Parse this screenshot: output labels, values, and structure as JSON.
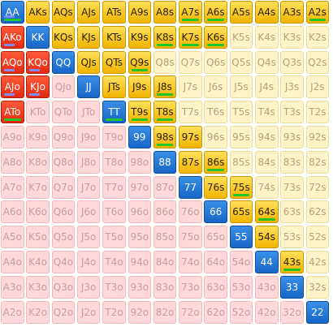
{
  "ranks": [
    "A",
    "K",
    "Q",
    "J",
    "T",
    "9",
    "8",
    "7",
    "6",
    "5",
    "4",
    "3",
    "2"
  ],
  "colors": {
    "pair": "#1866c8",
    "suited": "#f2b400",
    "light_suited": "#fff3c8",
    "offsuit_selected": "#e52a10",
    "offsuit": "#ffd9d9",
    "indicator_green": "#22c52a",
    "indicator_blue": "#7f8ef5"
  },
  "selected_pairs": [
    "AA",
    "KK",
    "QQ",
    "JJ",
    "TT",
    "99",
    "88",
    "77",
    "66",
    "55",
    "44",
    "33",
    "22"
  ],
  "selected_suited": [
    "AKs",
    "AQs",
    "AJs",
    "ATs",
    "A9s",
    "A8s",
    "A7s",
    "A6s",
    "A5s",
    "A4s",
    "A3s",
    "A2s",
    "KQs",
    "KJs",
    "KTs",
    "K9s",
    "K8s",
    "K7s",
    "K6s",
    "QJs",
    "QTs",
    "Q9s",
    "JTs",
    "J9s",
    "J8s",
    "T9s",
    "T8s",
    "98s",
    "97s",
    "87s",
    "86s",
    "76s",
    "75s",
    "65s",
    "64s",
    "54s",
    "43s"
  ],
  "selected_offsuit": [
    "AKo",
    "AQo",
    "KQo",
    "AJo",
    "KJo",
    "ATo"
  ],
  "indicators": {
    "AA": [
      "green",
      "blue"
    ],
    "A7s": [
      "green"
    ],
    "A6s": [
      "green"
    ],
    "A2s": [
      "green"
    ],
    "AKo": [
      "blue"
    ],
    "K8s": [
      "green"
    ],
    "K7s": [
      "green"
    ],
    "K6s": [
      "green"
    ],
    "AQo": [
      "blue"
    ],
    "KQo": [
      "blue"
    ],
    "Q9s": [
      "green"
    ],
    "AJo": [
      "blue"
    ],
    "KJo": [
      "blue"
    ],
    "J8s": [
      "green"
    ],
    "ATo": [
      "green"
    ],
    "TT": [
      "green"
    ],
    "T9s": [
      "green"
    ],
    "T8s": [
      "green"
    ],
    "98s": [
      "green"
    ],
    "86s": [
      "green"
    ],
    "75s": [
      "green"
    ],
    "64s": [
      "green"
    ],
    "43s": [
      "green"
    ]
  }
}
